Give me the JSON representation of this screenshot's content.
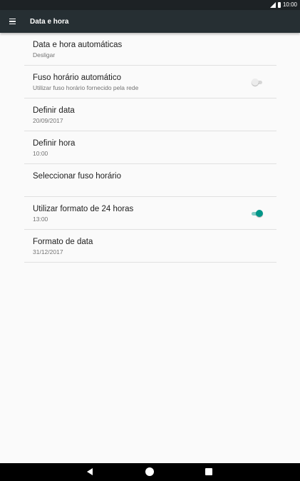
{
  "status_bar": {
    "time": "10:00",
    "icons": [
      "signal-icon",
      "battery-icon"
    ]
  },
  "app_bar": {
    "title": "Data e hora",
    "menu_icon": "hamburger-menu-icon"
  },
  "settings": [
    {
      "title": "Data e hora automáticas",
      "summary": "Desligar"
    },
    {
      "title": "Fuso horário automático",
      "summary": "Utilizar fuso horário fornecido pela rede",
      "switch": "off"
    },
    {
      "title": "Definir data",
      "summary": "20/09/2017"
    },
    {
      "title": "Definir hora",
      "summary": "10:00"
    },
    {
      "title": "Seleccionar fuso horário",
      "summary": ""
    },
    {
      "title": "Utilizar formato de 24 horas",
      "summary": "13:00",
      "switch": "on"
    },
    {
      "title": "Formato de data",
      "summary": "31/12/2017"
    }
  ],
  "nav_bar": {
    "icons": [
      "back-icon",
      "home-icon",
      "recents-icon"
    ]
  },
  "colors": {
    "app_bar": "#262f33",
    "status_bar": "#1d2225",
    "accent": "#009688",
    "background": "#fafafa"
  }
}
